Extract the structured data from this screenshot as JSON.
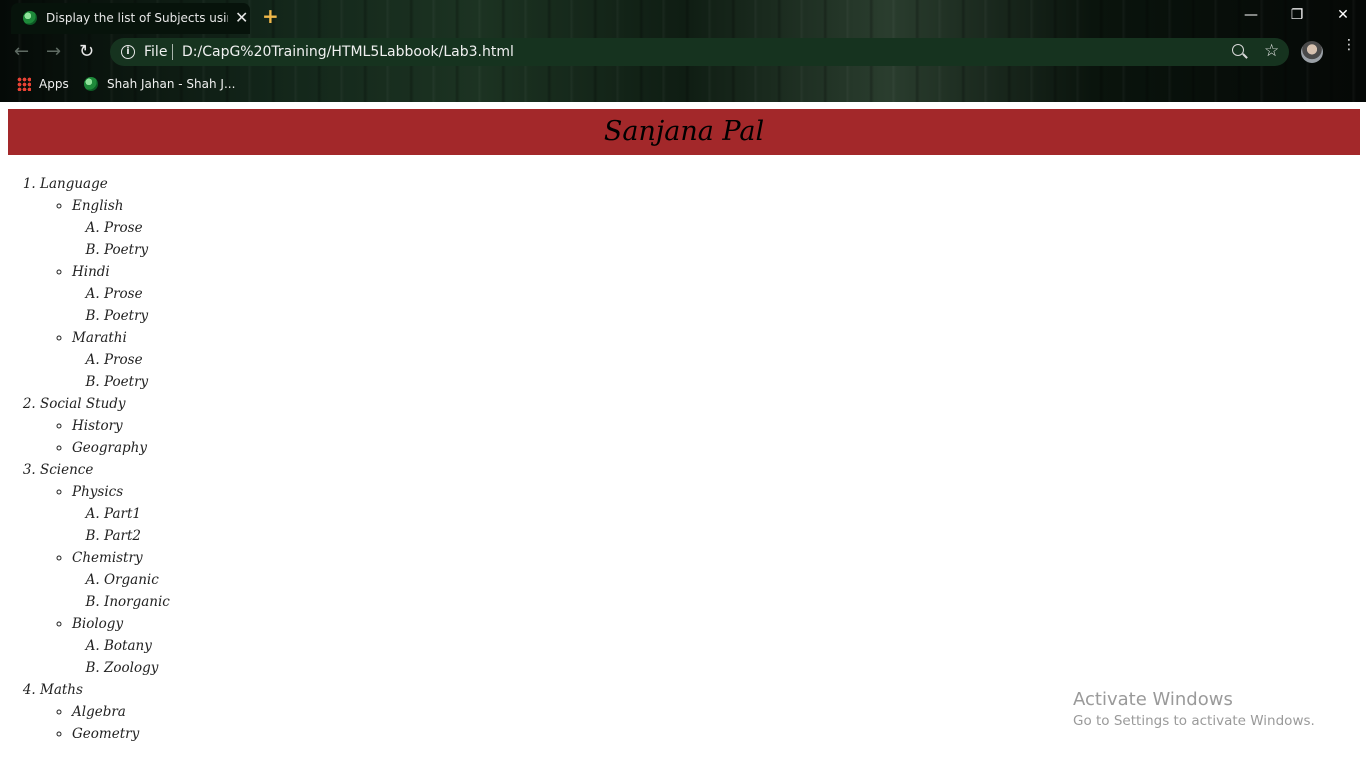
{
  "browser": {
    "tab_title": "Display the list of Subjects using",
    "tab_close": "✕",
    "new_tab": "+",
    "window": {
      "minimize": "—",
      "restore": "❐",
      "close": "✕"
    },
    "nav": {
      "back": "←",
      "forward": "→",
      "reload": "↻"
    },
    "omnibox": {
      "info": "i",
      "scheme_label": "File",
      "url": "D:/CapG%20Training/HTML5Labbook/Lab3.html"
    },
    "star": "☆",
    "menu": "⋮",
    "bookmarks": [
      {
        "label": "Apps",
        "icon": "apps-grid-icon"
      },
      {
        "label": "Shah Jahan - Shah J...",
        "icon": "globe-icon"
      }
    ]
  },
  "page": {
    "header": "Sanjana Pal",
    "subjects": [
      {
        "label": "Language",
        "topics": [
          {
            "label": "English",
            "parts": [
              "Prose",
              "Poetry"
            ]
          },
          {
            "label": "Hindi",
            "parts": [
              "Prose",
              "Poetry"
            ]
          },
          {
            "label": "Marathi",
            "parts": [
              "Prose",
              "Poetry"
            ]
          }
        ]
      },
      {
        "label": "Social Study",
        "topics": [
          {
            "label": "History",
            "parts": []
          },
          {
            "label": "Geography",
            "parts": []
          }
        ]
      },
      {
        "label": "Science",
        "topics": [
          {
            "label": "Physics",
            "parts": [
              "Part1",
              "Part2"
            ]
          },
          {
            "label": "Chemistry",
            "parts": [
              "Organic",
              "Inorganic"
            ]
          },
          {
            "label": "Biology",
            "parts": [
              "Botany",
              "Zoology"
            ]
          }
        ]
      },
      {
        "label": "Maths",
        "topics": [
          {
            "label": "Algebra",
            "parts": []
          },
          {
            "label": "Geometry",
            "parts": []
          }
        ]
      }
    ]
  },
  "watermark": {
    "title": "Activate Windows",
    "subtitle": "Go to Settings to activate Windows."
  },
  "colors": {
    "header_bg": "#a3282a",
    "omnibox_bg": "#16331f",
    "new_tab_accent": "#f0b84a"
  }
}
